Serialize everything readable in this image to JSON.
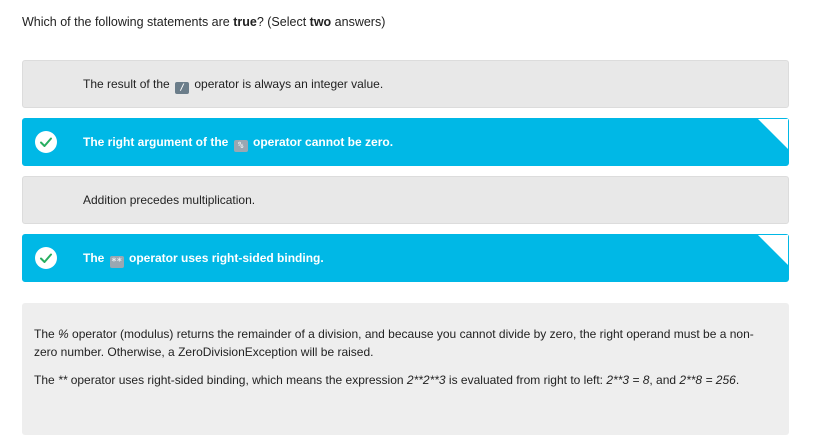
{
  "question": {
    "prefix": "Which of the following statements are ",
    "bold1": "true",
    "middle": "? (Select ",
    "bold2": "two",
    "suffix": " answers)"
  },
  "options": [
    {
      "before": "The result of the ",
      "chip": "/",
      "after": " operator is always an integer value.",
      "selected": false
    },
    {
      "before": "The right argument of the ",
      "chip": "%",
      "after": " operator cannot be zero.",
      "selected": true
    },
    {
      "text": "Addition precedes multiplication.",
      "selected": false
    },
    {
      "before": "The ",
      "chip": "**",
      "after": " operator uses right-sided binding.",
      "selected": true
    }
  ],
  "explanation": {
    "p1": {
      "a": "The ",
      "code": "%",
      "b": " operator (modulus) returns the remainder of a division, and because you cannot divide by zero, the right operand must be a non-zero number. Otherwise, a ZeroDivisionException will be raised."
    },
    "p2": {
      "a": "The ",
      "code1": "**",
      "b": " operator uses right-sided binding, which means the expression ",
      "code2": "2**2**3",
      "c": " is evaluated from right to left: ",
      "code3": "2**3 = 8",
      "d": ", and ",
      "code4": "2**8 = 256",
      "e": "."
    }
  },
  "colors": {
    "selected_bg": "#00b8e6",
    "option_bg": "#e8e8e8",
    "check_green": "#27ae60"
  }
}
